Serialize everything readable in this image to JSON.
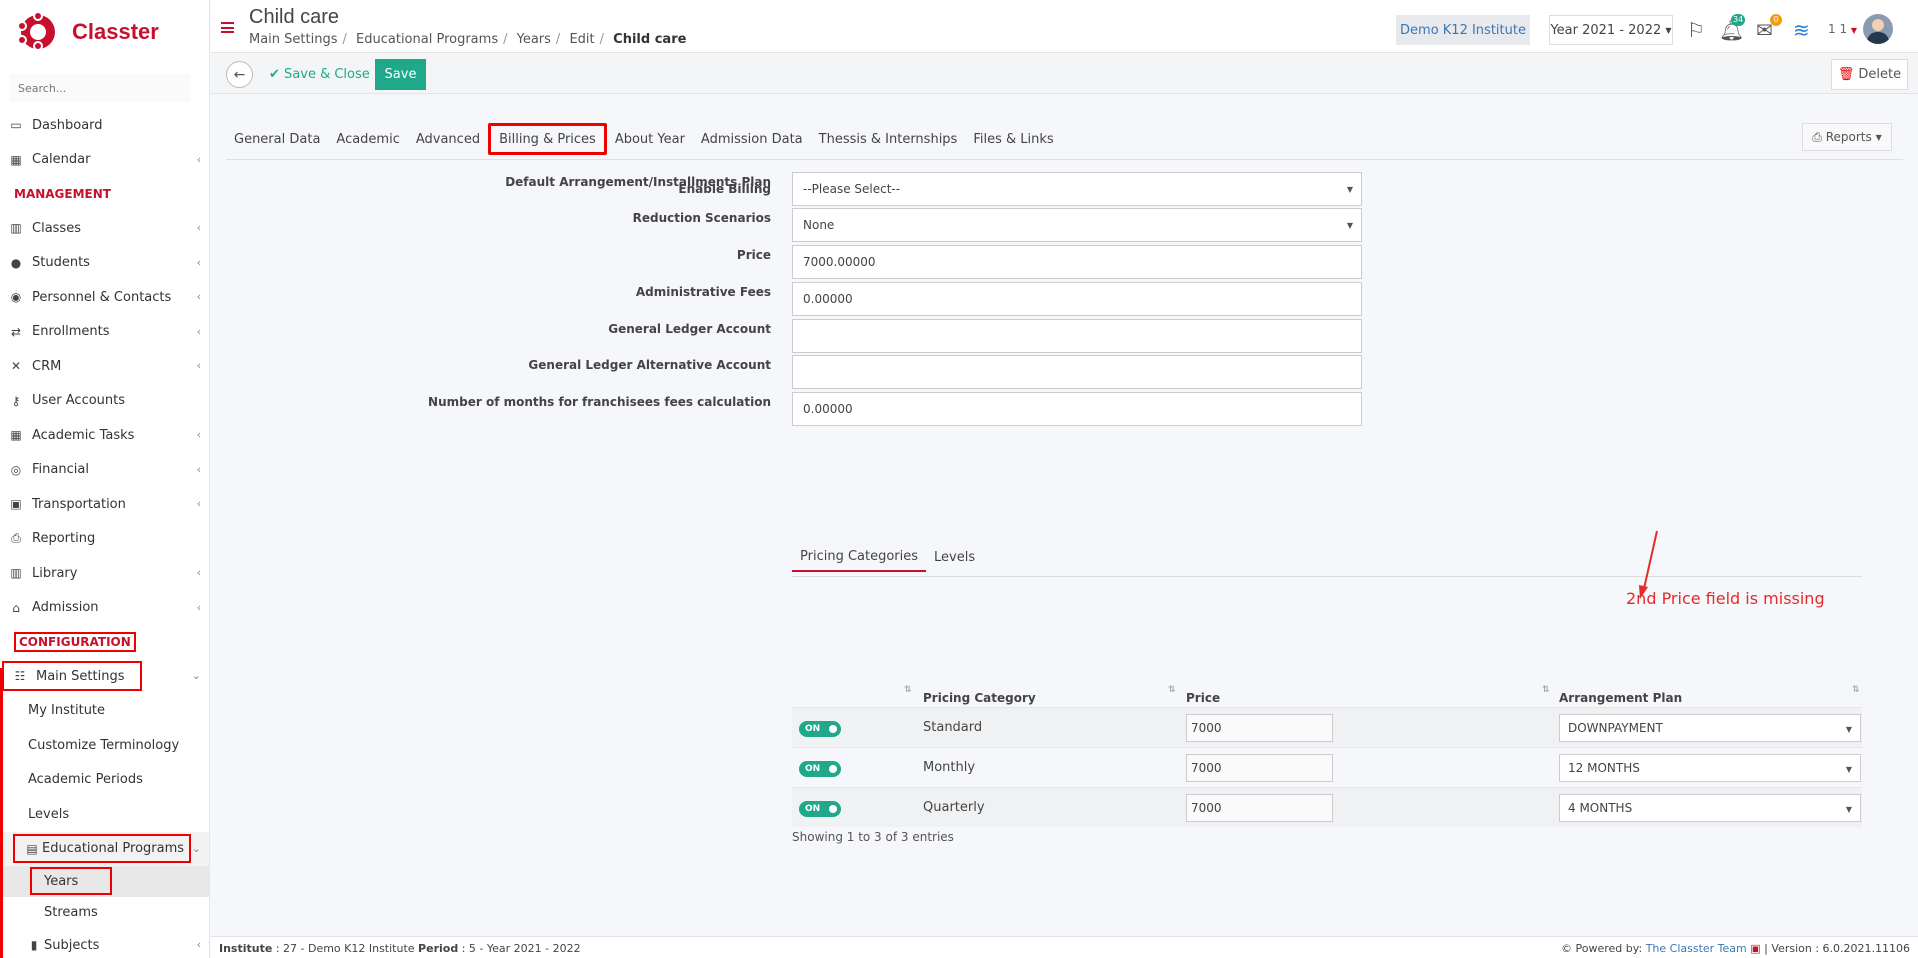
{
  "app": {
    "name": "Classter",
    "search_placeholder": "Search..."
  },
  "sidebar": {
    "top_items": [
      {
        "label": "Dashboard",
        "icon": "monitor-icon",
        "chev": false
      },
      {
        "label": "Calendar",
        "icon": "calendar-icon",
        "chev": true
      }
    ],
    "management_title": "MANAGEMENT",
    "management_items": [
      {
        "label": "Classes",
        "icon": "classes-icon",
        "chev": true
      },
      {
        "label": "Students",
        "icon": "students-icon",
        "chev": true
      },
      {
        "label": "Personnel & Contacts",
        "icon": "personnel-icon",
        "chev": true
      },
      {
        "label": "Enrollments",
        "icon": "exchange-icon",
        "chev": true
      },
      {
        "label": "CRM",
        "icon": "crm-icon",
        "chev": true
      },
      {
        "label": "User Accounts",
        "icon": "key-icon",
        "chev": false
      },
      {
        "label": "Academic Tasks",
        "icon": "grid-icon",
        "chev": true
      },
      {
        "label": "Financial",
        "icon": "coins-icon",
        "chev": true
      },
      {
        "label": "Transportation",
        "icon": "bus-icon",
        "chev": true
      },
      {
        "label": "Reporting",
        "icon": "printer-icon",
        "chev": false
      },
      {
        "label": "Library",
        "icon": "library-icon",
        "chev": true
      },
      {
        "label": "Admission",
        "icon": "bank-icon",
        "chev": true
      }
    ],
    "configuration_title": "CONFIGURATION",
    "main_settings": "Main Settings",
    "settings_items": [
      "My Institute",
      "Customize Terminology",
      "Academic Periods",
      "Levels"
    ],
    "educational_programs": "Educational Programs",
    "ep_items": [
      "Years",
      "Streams"
    ],
    "subjects": "Subjects"
  },
  "header": {
    "title": "Child care",
    "breadcrumbs": [
      "Main Settings",
      "Educational Programs",
      "Years",
      "Edit"
    ],
    "breadcrumb_current": "Child care",
    "institute": "Demo K12 Institute",
    "year": "Year 2021 - 2022",
    "notif_count": "34",
    "mail_count": "0",
    "user_label": "1 1"
  },
  "actions": {
    "save_close": "Save & Close",
    "save": "Save",
    "delete": "Delete"
  },
  "tabs": [
    "General Data",
    "Academic",
    "Advanced",
    "Billing & Prices",
    "About Year",
    "Admission Data",
    "Thessis & Internships",
    "Files & Links"
  ],
  "reports": "Reports",
  "form": {
    "enable_billing_label": "Enable Billing",
    "toggle_on": "ON",
    "fields": [
      {
        "label": "Default Arrangement/Installments Plan",
        "value": "--Please Select--",
        "select": true
      },
      {
        "label": "Reduction Scenarios",
        "value": "None",
        "select": true
      },
      {
        "label": "Price",
        "value": "7000.00000",
        "select": false
      },
      {
        "label": "Administrative Fees",
        "value": "0.00000",
        "select": false
      },
      {
        "label": "General Ledger Account",
        "value": "",
        "select": false
      },
      {
        "label": "General Ledger Alternative Account",
        "value": "",
        "select": false
      },
      {
        "label": "Number of months for franchisees fees calculation",
        "value": "0.00000",
        "select": false
      }
    ]
  },
  "subtabs": [
    "Pricing Categories",
    "Levels"
  ],
  "pricing_table": {
    "headers": [
      "Pricing Category",
      "Price",
      "Arrangement Plan"
    ],
    "rows": [
      {
        "category": "Standard",
        "price": "7000",
        "plan": "DOWNPAYMENT"
      },
      {
        "category": "Monthly",
        "price": "7000",
        "plan": "12 MONTHS"
      },
      {
        "category": "Quarterly",
        "price": "7000",
        "plan": "4 MONTHS"
      }
    ],
    "showing": "Showing 1 to 3 of 3 entries"
  },
  "annotation": "2nd Price field is missing",
  "footer": {
    "institute_label": "Institute",
    "institute_value": ": 27 - Demo K12 Institute",
    "period_label": "Period",
    "period_value": ": 5 - Year 2021 - 2022",
    "powered": "Powered by:",
    "team": "The Classter Team",
    "version": "| Version : 6.0.2021.11106"
  },
  "colors": {
    "brand": "#c8102e",
    "accent": "#1fa88a",
    "annotation": "#e32b2b"
  }
}
